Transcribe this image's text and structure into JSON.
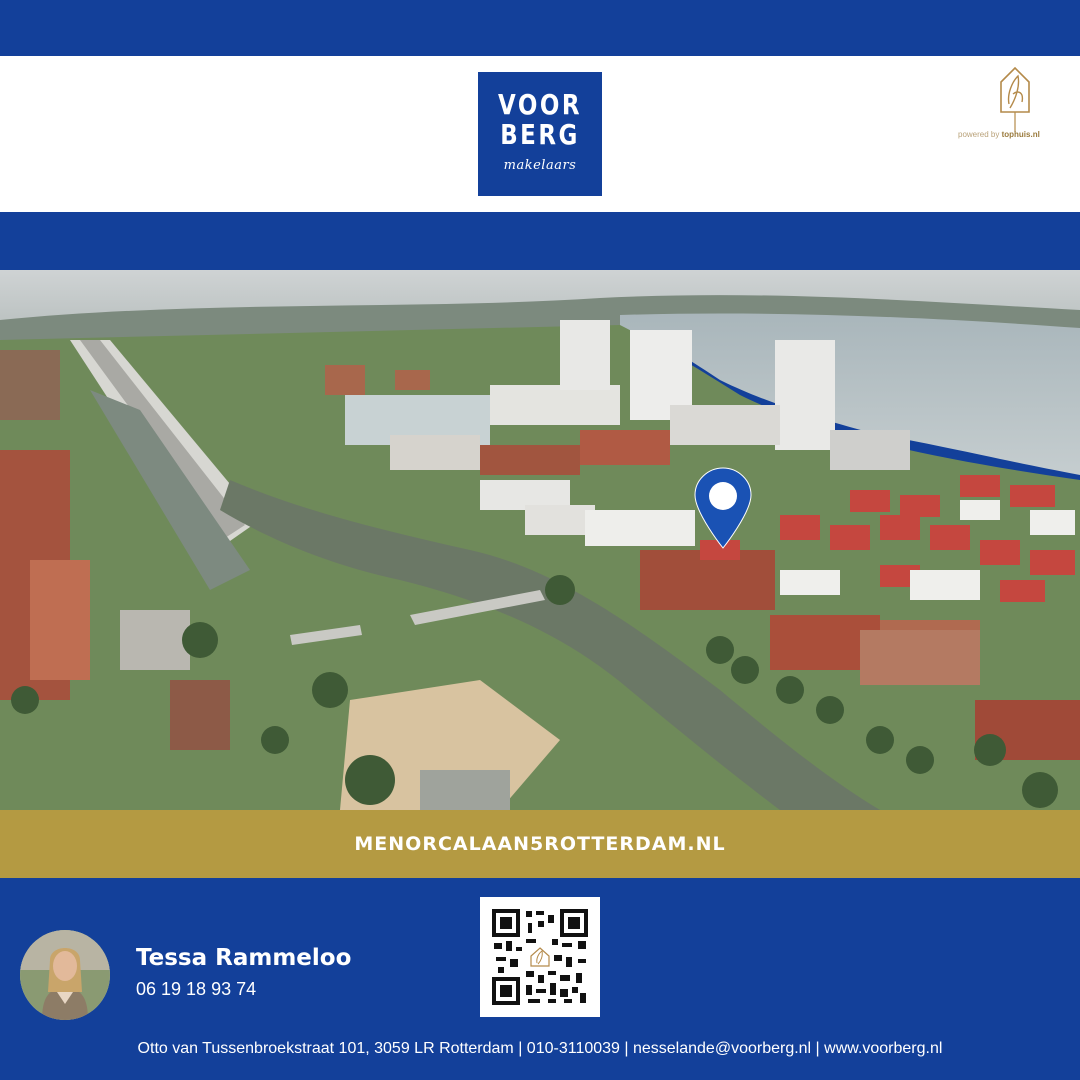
{
  "header": {
    "logo": {
      "line1": "VOOR",
      "line2": "BERG",
      "line3": "makelaars"
    },
    "partner": {
      "powered_by": "powered by",
      "brand": "tophuis.nl",
      "icon": "tophuis-logo-icon"
    }
  },
  "photo": {
    "marker_icon": "location-pin-icon"
  },
  "banner": {
    "url_text": "MENORCALAAN5ROTTERDAM.NL"
  },
  "agent": {
    "name": "Tessa Rammeloo",
    "phone": "06 19 18 93 74"
  },
  "qr": {
    "icon": "qr-code-icon"
  },
  "footer": {
    "text": "Otto van Tussenbroekstraat 101, 3059 LR Rotterdam | 010-3110039 | nesselande@voorberg.nl | www.voorberg.nl"
  },
  "colors": {
    "brand_blue": "#13409a",
    "gold": "#b49a42",
    "white": "#ffffff"
  }
}
